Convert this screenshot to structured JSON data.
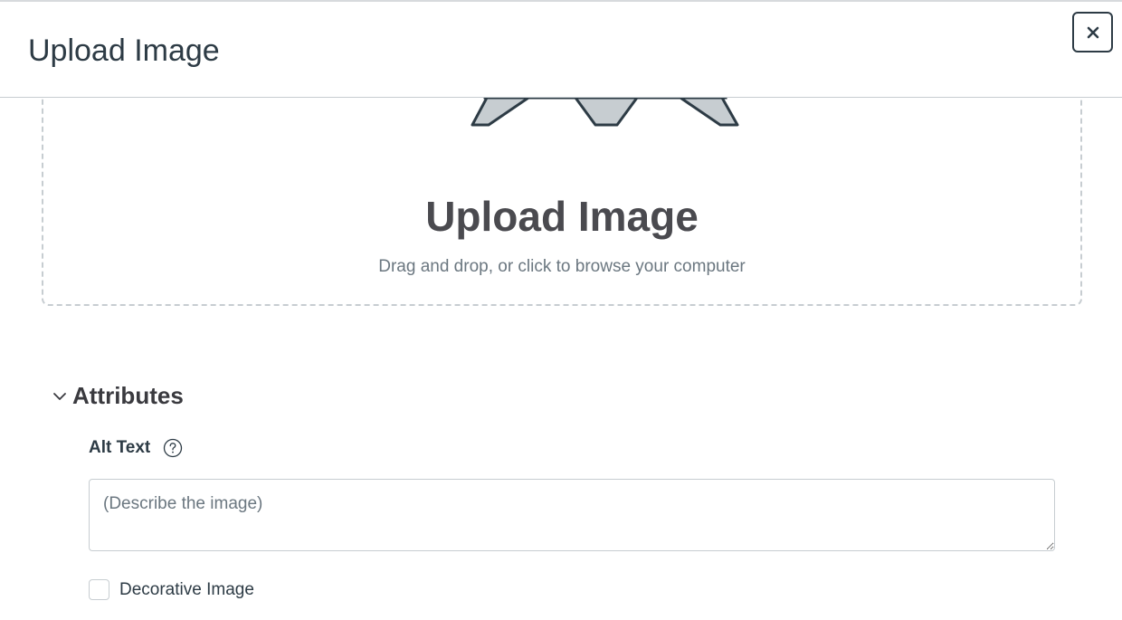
{
  "modal": {
    "title": "Upload Image",
    "close_label": "Close",
    "close_icon": "close-icon"
  },
  "dropzone": {
    "heading": "Upload Image",
    "hint": "Drag and drop, or click to browse your computer",
    "illustration_icon": "upload-illustration"
  },
  "attributes": {
    "title": "Attributes",
    "toggle_icon": "chevron-down-icon",
    "alt_text": {
      "label": "Alt Text",
      "help_icon": "question-mark-icon",
      "value": "",
      "placeholder": "(Describe the image)"
    },
    "decorative": {
      "label": "Decorative Image",
      "checked": false
    }
  },
  "colors": {
    "text": "#2d3b45",
    "heading": "#4a4a4f",
    "muted": "#6b7780",
    "border": "#c7cdd1",
    "illustration_fill": "#c7cdd1"
  }
}
